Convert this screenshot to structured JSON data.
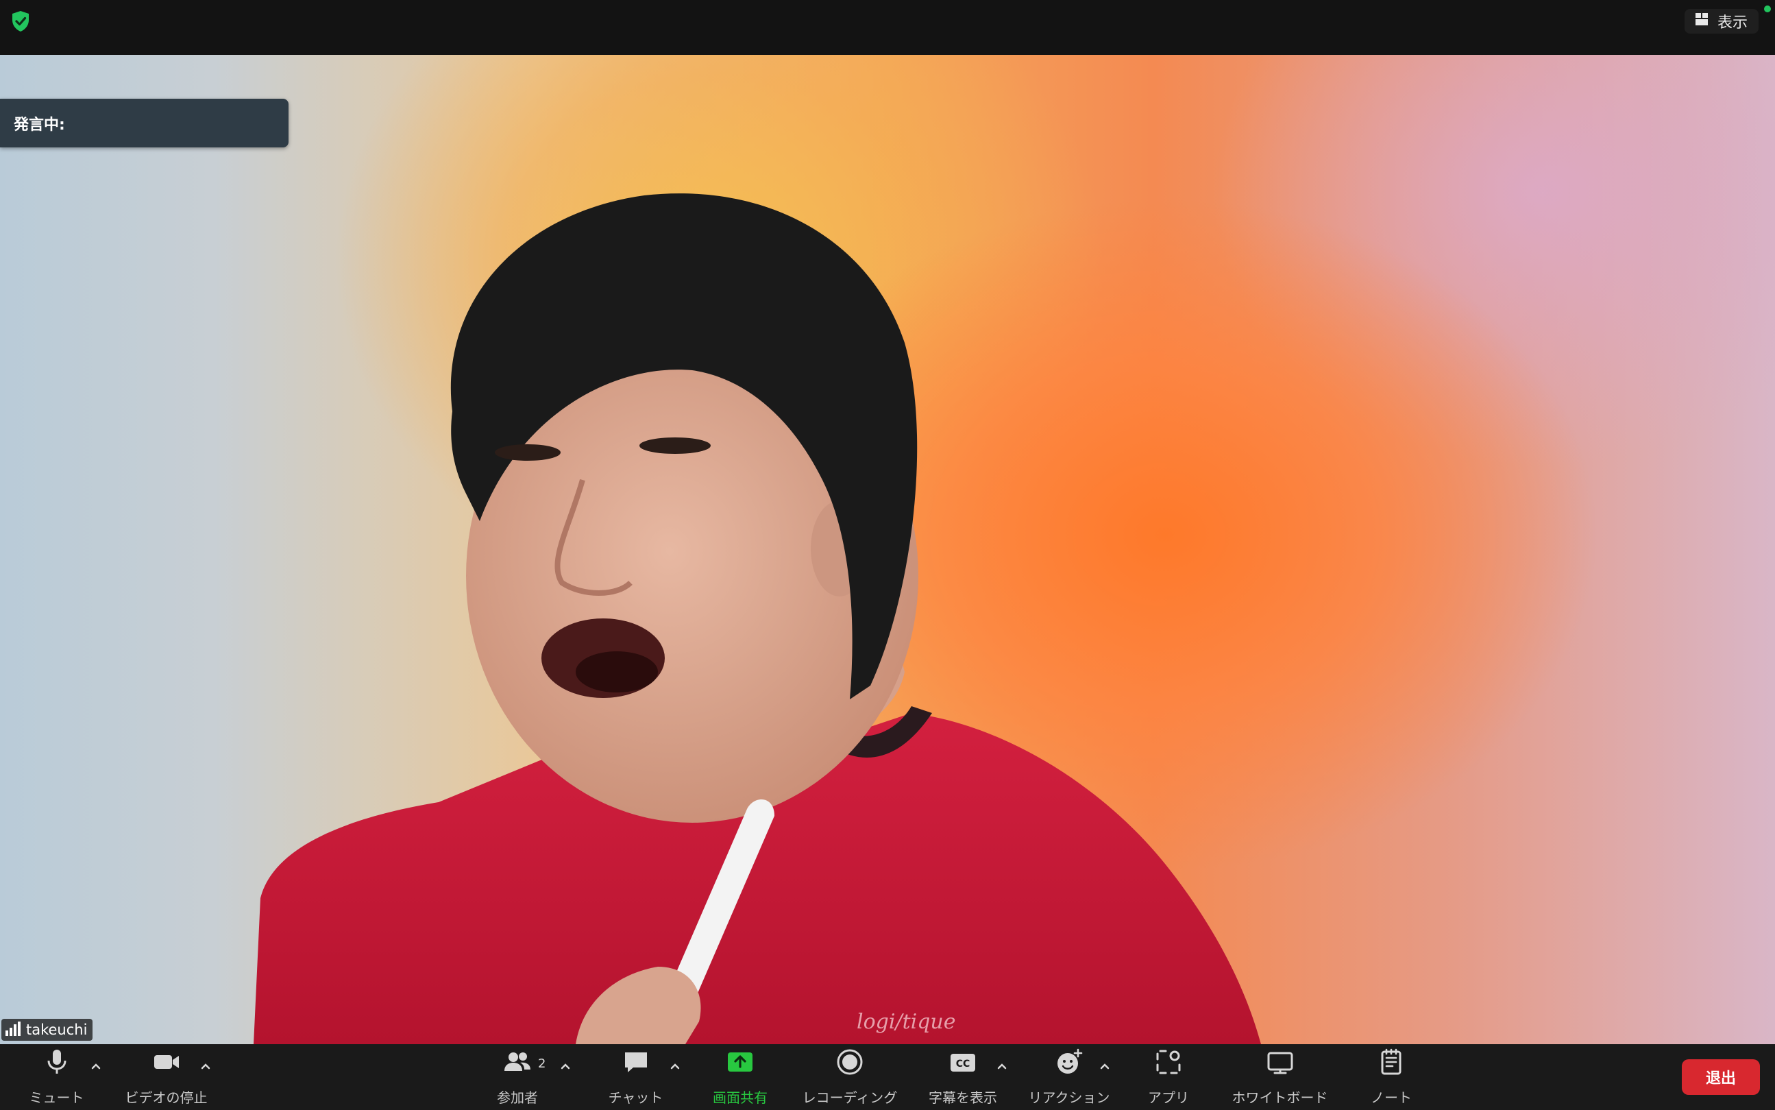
{
  "top_bar": {
    "security_icon": "shield-check-icon",
    "view_label": "表示",
    "view_icon": "grid-icon",
    "colors": {
      "shield": "#22c55e",
      "indicator": "#22c55e"
    }
  },
  "video": {
    "speaking_label": "発言中:",
    "participant_name": "takeuchi",
    "signal_icon": "signal-bars-icon"
  },
  "toolbar": {
    "mute": {
      "label": "ミュート",
      "icon": "microphone-icon"
    },
    "video_stop": {
      "label": "ビデオの停止",
      "icon": "video-camera-icon"
    },
    "participants": {
      "label": "参加者",
      "icon": "people-icon",
      "count": "2"
    },
    "chat": {
      "label": "チャット",
      "icon": "chat-bubble-icon"
    },
    "share_screen": {
      "label": "画面共有",
      "icon": "share-up-arrow-icon",
      "color": "#28c840"
    },
    "recording": {
      "label": "レコーディング",
      "icon": "record-icon"
    },
    "captions": {
      "label": "字幕を表示",
      "icon": "cc-icon",
      "icon_text": "CC"
    },
    "reactions": {
      "label": "リアクション",
      "icon": "emoji-add-icon"
    },
    "apps": {
      "label": "アプリ",
      "icon": "apps-icon"
    },
    "whiteboard": {
      "label": "ホワイトボード",
      "icon": "whiteboard-icon"
    },
    "notes": {
      "label": "ノート",
      "icon": "notes-icon"
    },
    "leave": {
      "label": "退出",
      "color": "#d8282f"
    }
  }
}
